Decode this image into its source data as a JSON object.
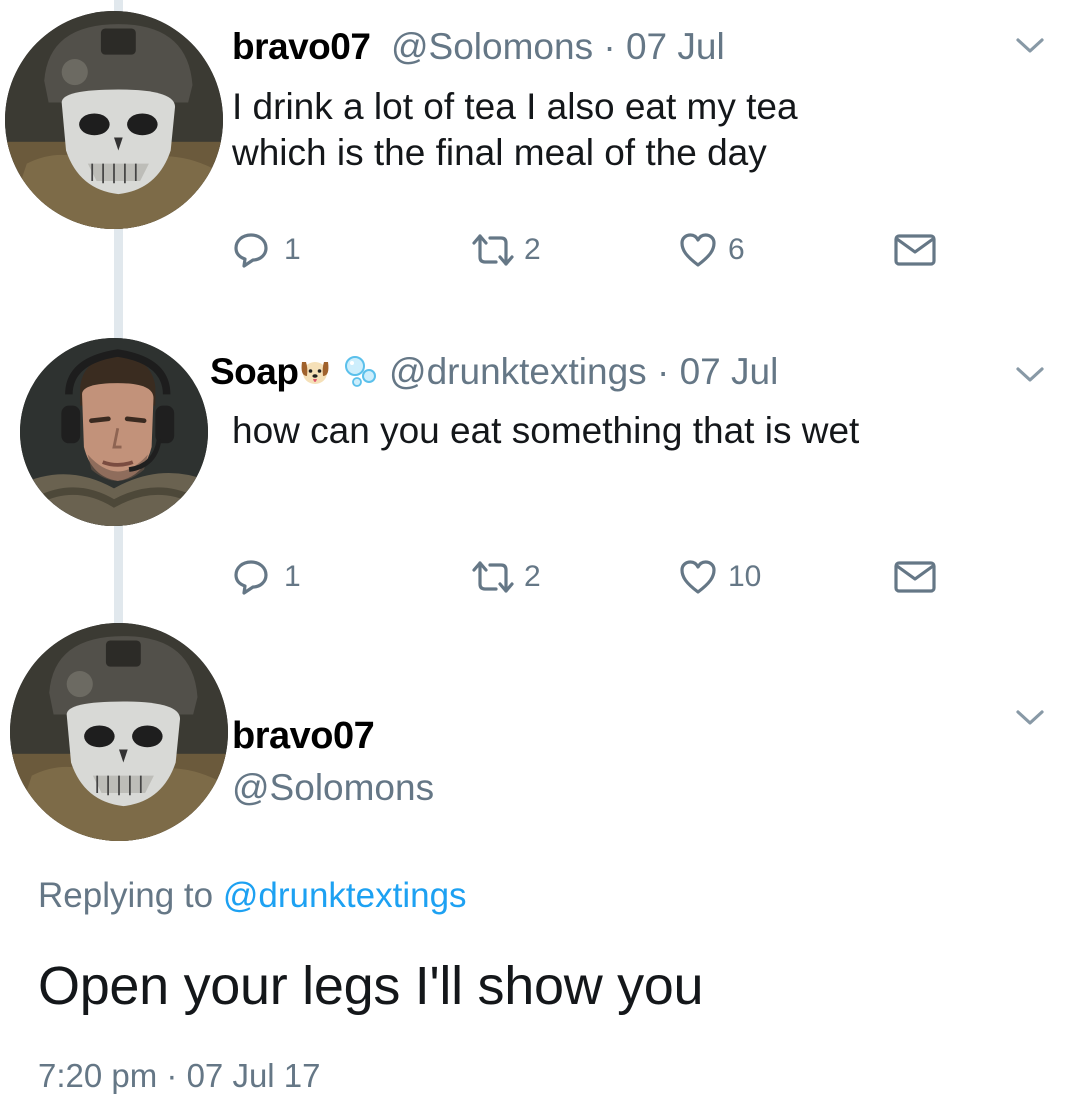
{
  "tweets": [
    {
      "display_name": "bravo07",
      "handle": "@Solomons",
      "date": "07 Jul",
      "text_lines": [
        "I drink a lot of tea I also eat my tea",
        "which is the final meal of the day"
      ],
      "replies": "1",
      "retweets": "2",
      "likes": "6",
      "avatar_icon": "skull-mask-soldier-avatar"
    },
    {
      "display_name": "Soap",
      "name_emoji": [
        "dog-face-emoji",
        "bubbles-emoji"
      ],
      "handle": "@drunktextings",
      "date": "07 Jul",
      "text_lines": [
        "how can you eat something that is wet"
      ],
      "replies": "1",
      "retweets": "2",
      "likes": "10",
      "avatar_icon": "soldier-headset-avatar"
    }
  ],
  "main_tweet": {
    "display_name": "bravo07",
    "handle": "@Solomons",
    "replying_prefix": "Replying to",
    "replying_to": "@drunktextings",
    "text": "Open your legs I'll show you",
    "timestamp": "7:20 pm · 07 Jul 17",
    "avatar_icon": "skull-mask-soldier-avatar"
  },
  "separator": "·",
  "colors": {
    "secondary_text": "#657786",
    "mention": "#1da1f2",
    "thread_line": "#e1e8ed"
  },
  "icons": [
    "reply-icon",
    "retweet-icon",
    "like-icon",
    "direct-message-icon",
    "chevron-down-icon"
  ]
}
